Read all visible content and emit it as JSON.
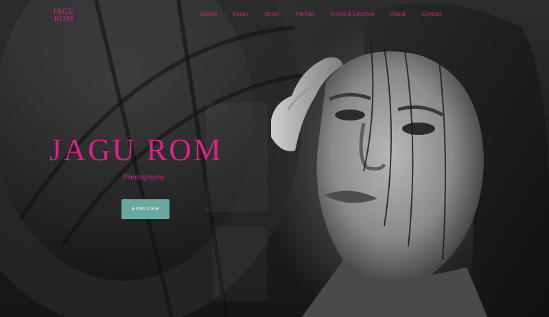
{
  "brand": {
    "logo_line1": "JAGU",
    "logo_line2": "ROM",
    "accent_color": "#d6238a",
    "button_color": "#68a8a1"
  },
  "nav": {
    "items": [
      {
        "label": "Dance"
      },
      {
        "label": "Music"
      },
      {
        "label": "Street"
      },
      {
        "label": "Portrait"
      },
      {
        "label": "Travel & Lifestyle"
      },
      {
        "label": "About"
      },
      {
        "label": "Contact"
      }
    ]
  },
  "hero": {
    "title": "JAGU ROM",
    "subtitle": "Photography",
    "cta_label": "EXPLORE",
    "image": "black-and-white-portrait-photo"
  }
}
